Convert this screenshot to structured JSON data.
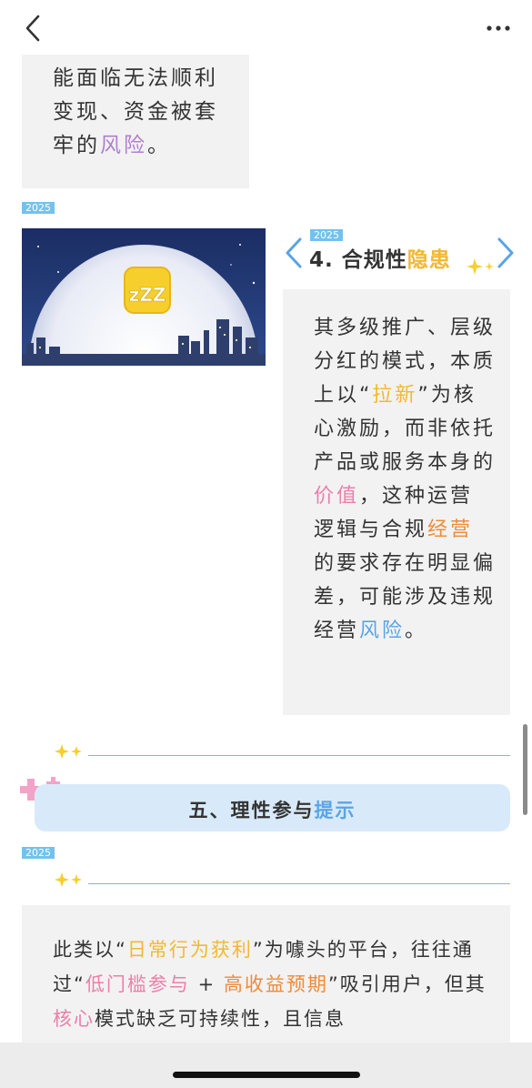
{
  "nav": {
    "back_icon": "chevron-left-icon",
    "more_icon": "more-icon"
  },
  "card1": {
    "text_main": "能面临无法顺利变现、资金被套牢的",
    "text_hl": "风险",
    "text_end": "。"
  },
  "badges": {
    "year": "2025"
  },
  "section4": {
    "title_main": "4. 合规性",
    "title_hl": "隐患",
    "body": [
      {
        "t": "其多级推广、层级分红的模式，本质上以“"
      },
      {
        "t": "拉新",
        "c": "yellow"
      },
      {
        "t": "”为核心激励，而非依托产品或服务本身的"
      },
      {
        "t": "价值",
        "c": "pink"
      },
      {
        "t": "，这种运营逻辑与合规"
      },
      {
        "t": "经营",
        "c": "orange"
      },
      {
        "t": "的要求存在明显偏差，可能涉及违规经营"
      },
      {
        "t": "风险",
        "c": "blue"
      },
      {
        "t": "。"
      }
    ]
  },
  "section5": {
    "title_main": "五、理性参与",
    "title_hl": "提示",
    "body": [
      {
        "t": "此类以“"
      },
      {
        "t": "日常行为获利",
        "c": "yellow"
      },
      {
        "t": "”为噱头的平台，往往通过“"
      },
      {
        "t": "低门槛参与",
        "c": "pink"
      },
      {
        "t": " + "
      },
      {
        "t": "高收益预期",
        "c": "orange"
      },
      {
        "t": "”吸引用户，但其"
      },
      {
        "t": "核心",
        "c": "pink"
      },
      {
        "t": "模式缺乏可持续性，且信息"
      }
    ]
  },
  "colors": {
    "accent_blue": "#5aa4e6",
    "accent_yellow": "#f2b830",
    "accent_pink": "#ec7fa8",
    "accent_orange": "#ee8b3a",
    "accent_purple": "#b07fd0",
    "card_bg": "#f2f2f2",
    "section_bg": "#d8eafa"
  }
}
